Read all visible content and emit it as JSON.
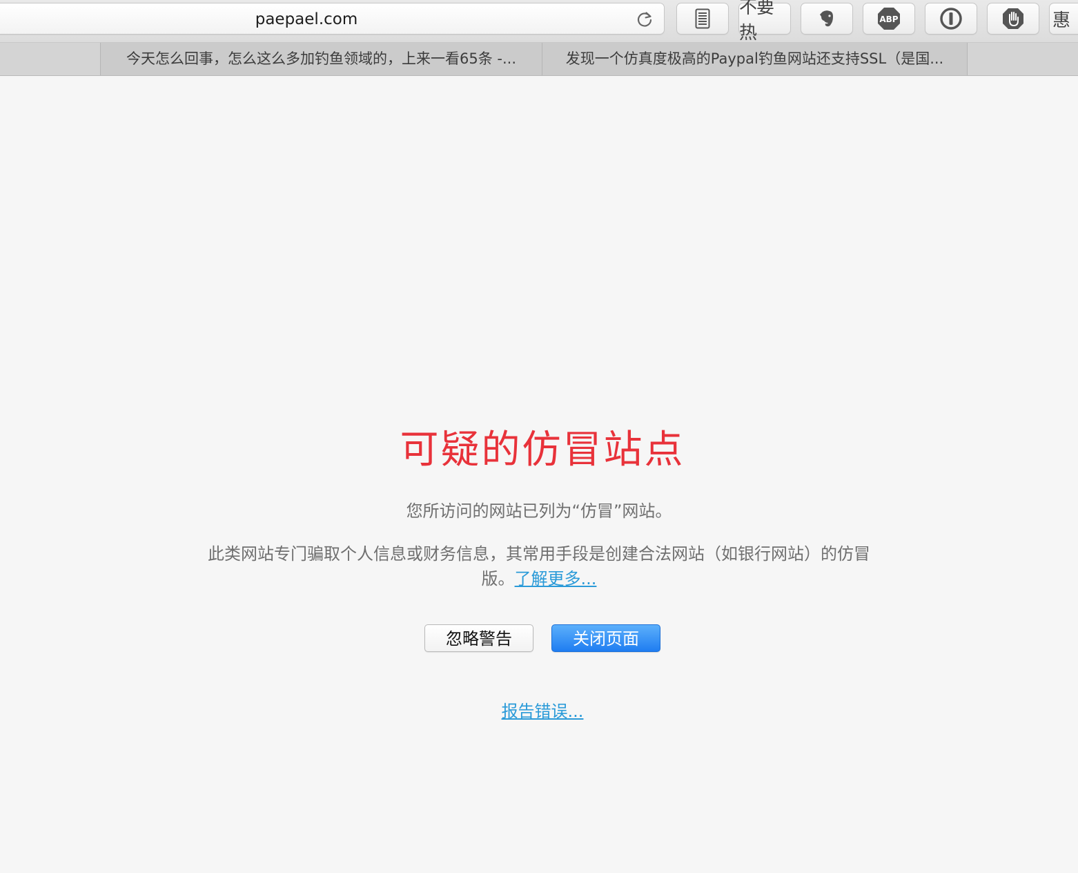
{
  "browser": {
    "address": "paepael.com",
    "extensions": {
      "readwise_label": "",
      "buzhu_label": "不要热",
      "abp_label": "ABP",
      "cut_glyph": "惠"
    },
    "tabs": [
      {
        "label": "今天怎么回事，怎么这么多加钓鱼领域的，上来一看65条 -..."
      },
      {
        "label": "发现一个仿真度极高的Paypal钓鱼网站还支持SSL（是国..."
      }
    ]
  },
  "warning": {
    "title": "可疑的仿冒站点",
    "line1": "您所访问的网站已列为“仿冒”网站。",
    "paragraph": "此类网站专门骗取个人信息或财务信息，其常用手段是创建合法网站（如银行网站）的仿冒版。",
    "learn_more": "了解更多...",
    "ignore_button": "忽略警告",
    "close_button": "关闭页面",
    "report_link": "报告错误..."
  },
  "colors": {
    "title_red": "#e8323a",
    "link_blue": "#2a9ad8",
    "primary_button": "#1f7df1",
    "background": "#f6f6f6"
  }
}
